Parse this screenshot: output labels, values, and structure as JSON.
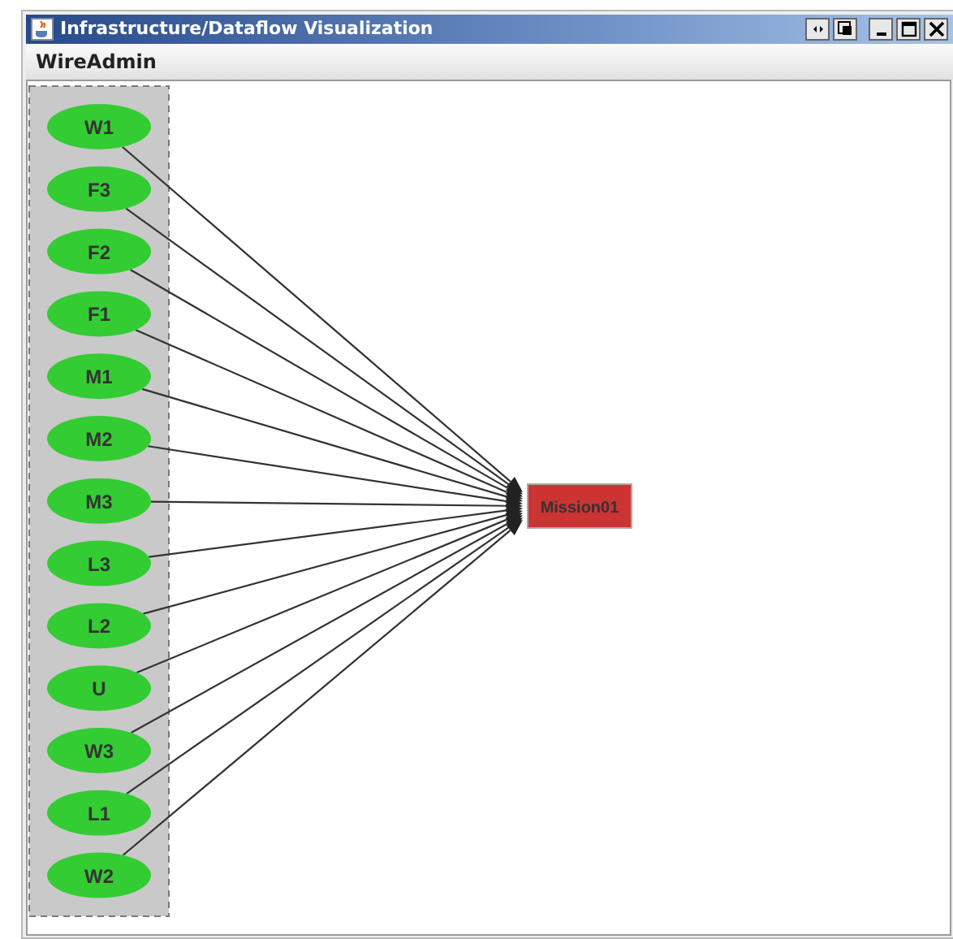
{
  "window": {
    "title": "Infrastructure/Dataflow Visualization"
  },
  "menu": [
    "WireAdmin"
  ],
  "graph": {
    "sources": [
      {
        "label": "W1"
      },
      {
        "label": "F3"
      },
      {
        "label": "F2"
      },
      {
        "label": "F1"
      },
      {
        "label": "M1"
      },
      {
        "label": "M2"
      },
      {
        "label": "M3"
      },
      {
        "label": "L3"
      },
      {
        "label": "L2"
      },
      {
        "label": "U"
      },
      {
        "label": "W3"
      },
      {
        "label": "L1"
      },
      {
        "label": "W2"
      }
    ],
    "target": {
      "label": "Mission01"
    }
  }
}
